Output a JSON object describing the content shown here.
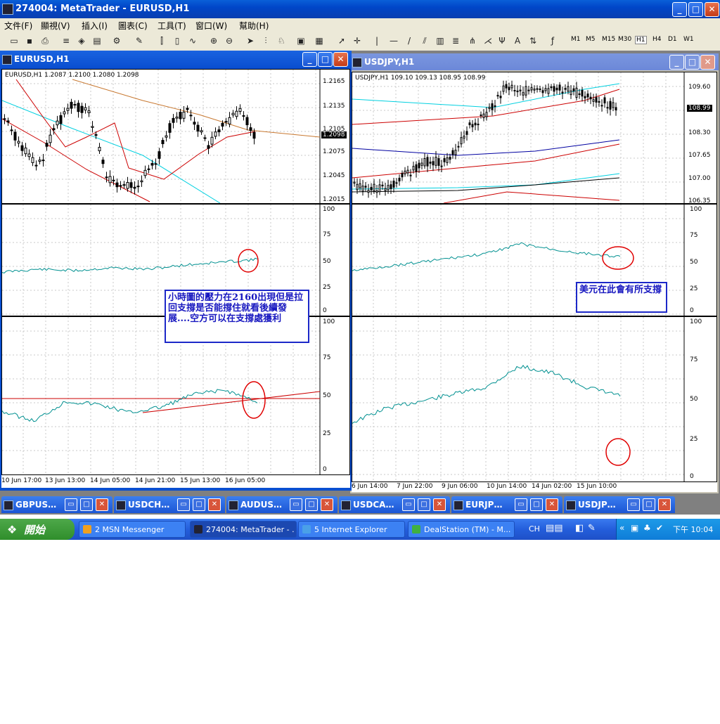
{
  "window": {
    "title": "274004: MetaTrader - EURUSD,H1"
  },
  "menu": [
    "文件(F)",
    "顯視(V)",
    "插入(I)",
    "圖表(C)",
    "工具(T)",
    "窗口(W)",
    "幫助(H)"
  ],
  "timeframes": [
    "M1",
    "M5",
    "M15",
    "M30",
    "H1",
    "H4",
    "D1",
    "W1"
  ],
  "timeframe_selected": "H1",
  "eurusd": {
    "title": "EURUSD,H1",
    "info": "EURUSD,H1  1.2087 1.2100 1.2080 1.2098",
    "price_labels": [
      "1.2165",
      "1.2135",
      "1.2105",
      "1.2075",
      "1.2045",
      "1.2015"
    ],
    "current_price": "1.2098",
    "osc_labels_1": [
      "100",
      "75",
      "50",
      "25",
      "0"
    ],
    "osc_labels_2": [
      "100",
      "75",
      "50",
      "25",
      "0"
    ],
    "time_labels": [
      "10 Jun 17:00",
      "13 Jun 13:00",
      "14 Jun 05:00",
      "14 Jun 21:00",
      "15 Jun 13:00",
      "16 Jun 05:00"
    ],
    "note": "小時圖的壓力在2160出現但是拉回支撐是否能撐住就看後續發展....空方可以在支撐處獲利"
  },
  "usdjpy": {
    "title": "USDJPY,H1",
    "info": "USDJPY,H1  109.10 109.13 108.95 108.99",
    "price_labels": [
      "109.60",
      "108.30",
      "107.65",
      "107.00",
      "106.35"
    ],
    "current_price": "108.99",
    "osc_labels_1": [
      "100",
      "75",
      "50",
      "25",
      "0"
    ],
    "osc_labels_2": [
      "100",
      "75",
      "50",
      "25",
      "0"
    ],
    "time_labels": [
      "6 Jun 14:00",
      "7 Jun 22:00",
      "9 Jun 06:00",
      "10 Jun 14:00",
      "14 Jun 02:00",
      "15 Jun 10:00"
    ],
    "note": "美元在此會有所支撐"
  },
  "minimized": [
    "GBPUS…",
    "USDCH…",
    "AUDUS…",
    "USDCA…",
    "EURJP…",
    "USDJP…"
  ],
  "taskbar": {
    "start": "開始",
    "tasks": [
      "2 MSN Messenger",
      "274004: MetaTrader - ...",
      "5 Internet Explorer",
      "DealStation (TM) - M..."
    ],
    "lang": "CH",
    "time": "下午 10:04"
  },
  "colors": {
    "title_blue": "#0a4fd0",
    "candle": "#000000",
    "ma_red": "#cc0000",
    "ma_cyan": "#00d0e0",
    "ma_orange": "#c87830",
    "ma_blue": "#0000a0",
    "osc_line": "#009090",
    "note_border": "#1c28c8"
  }
}
